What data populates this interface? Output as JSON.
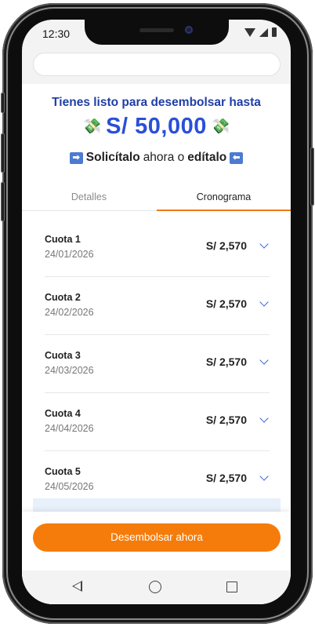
{
  "status_bar": {
    "time": "12:30",
    "icons": [
      "wifi-icon",
      "signal-icon",
      "battery-icon"
    ]
  },
  "hero": {
    "title": "Tienes listo para desembolsar hasta",
    "amount": "S/ 50,000",
    "money_icon": "💸",
    "sub_bold_1": "Solicítalo",
    "sub_mid": "ahora o",
    "sub_bold_2": "edítalo",
    "arrow_right": "➡",
    "arrow_left": "⬅"
  },
  "tabs": [
    {
      "label": "Detalles",
      "active": false
    },
    {
      "label": "Cronograma",
      "active": true
    }
  ],
  "quotas": [
    {
      "name": "Cuota 1",
      "date": "24/01/2026",
      "amount": "S/ 2,570"
    },
    {
      "name": "Cuota 2",
      "date": "24/02/2026",
      "amount": "S/ 2,570"
    },
    {
      "name": "Cuota 3",
      "date": "24/03/2026",
      "amount": "S/ 2,570"
    },
    {
      "name": "Cuota 4",
      "date": "24/04/2026",
      "amount": "S/ 2,570"
    },
    {
      "name": "Cuota 5",
      "date": "24/05/2026",
      "amount": "S/ 2,570"
    }
  ],
  "cta": {
    "label": "Desembolsar ahora"
  },
  "colors": {
    "brand_blue": "#2a4fd8",
    "accent_orange": "#f57c0a",
    "tab_active": "#f07a14"
  }
}
